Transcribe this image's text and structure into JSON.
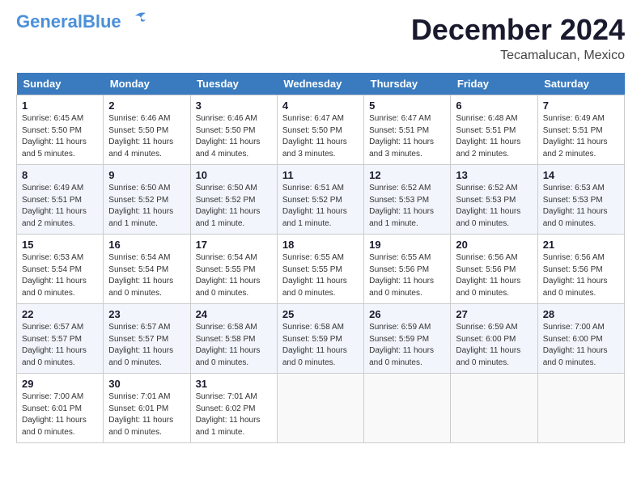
{
  "logo": {
    "part1": "General",
    "part2": "Blue"
  },
  "title": {
    "month": "December 2024",
    "location": "Tecamalucan, Mexico"
  },
  "weekdays": [
    "Sunday",
    "Monday",
    "Tuesday",
    "Wednesday",
    "Thursday",
    "Friday",
    "Saturday"
  ],
  "weeks": [
    [
      {
        "day": "1",
        "sunrise": "6:45 AM",
        "sunset": "5:50 PM",
        "daylight": "11 hours and 5 minutes."
      },
      {
        "day": "2",
        "sunrise": "6:46 AM",
        "sunset": "5:50 PM",
        "daylight": "11 hours and 4 minutes."
      },
      {
        "day": "3",
        "sunrise": "6:46 AM",
        "sunset": "5:50 PM",
        "daylight": "11 hours and 4 minutes."
      },
      {
        "day": "4",
        "sunrise": "6:47 AM",
        "sunset": "5:50 PM",
        "daylight": "11 hours and 3 minutes."
      },
      {
        "day": "5",
        "sunrise": "6:47 AM",
        "sunset": "5:51 PM",
        "daylight": "11 hours and 3 minutes."
      },
      {
        "day": "6",
        "sunrise": "6:48 AM",
        "sunset": "5:51 PM",
        "daylight": "11 hours and 2 minutes."
      },
      {
        "day": "7",
        "sunrise": "6:49 AM",
        "sunset": "5:51 PM",
        "daylight": "11 hours and 2 minutes."
      }
    ],
    [
      {
        "day": "8",
        "sunrise": "6:49 AM",
        "sunset": "5:51 PM",
        "daylight": "11 hours and 2 minutes."
      },
      {
        "day": "9",
        "sunrise": "6:50 AM",
        "sunset": "5:52 PM",
        "daylight": "11 hours and 1 minute."
      },
      {
        "day": "10",
        "sunrise": "6:50 AM",
        "sunset": "5:52 PM",
        "daylight": "11 hours and 1 minute."
      },
      {
        "day": "11",
        "sunrise": "6:51 AM",
        "sunset": "5:52 PM",
        "daylight": "11 hours and 1 minute."
      },
      {
        "day": "12",
        "sunrise": "6:52 AM",
        "sunset": "5:53 PM",
        "daylight": "11 hours and 1 minute."
      },
      {
        "day": "13",
        "sunrise": "6:52 AM",
        "sunset": "5:53 PM",
        "daylight": "11 hours and 0 minutes."
      },
      {
        "day": "14",
        "sunrise": "6:53 AM",
        "sunset": "5:53 PM",
        "daylight": "11 hours and 0 minutes."
      }
    ],
    [
      {
        "day": "15",
        "sunrise": "6:53 AM",
        "sunset": "5:54 PM",
        "daylight": "11 hours and 0 minutes."
      },
      {
        "day": "16",
        "sunrise": "6:54 AM",
        "sunset": "5:54 PM",
        "daylight": "11 hours and 0 minutes."
      },
      {
        "day": "17",
        "sunrise": "6:54 AM",
        "sunset": "5:55 PM",
        "daylight": "11 hours and 0 minutes."
      },
      {
        "day": "18",
        "sunrise": "6:55 AM",
        "sunset": "5:55 PM",
        "daylight": "11 hours and 0 minutes."
      },
      {
        "day": "19",
        "sunrise": "6:55 AM",
        "sunset": "5:56 PM",
        "daylight": "11 hours and 0 minutes."
      },
      {
        "day": "20",
        "sunrise": "6:56 AM",
        "sunset": "5:56 PM",
        "daylight": "11 hours and 0 minutes."
      },
      {
        "day": "21",
        "sunrise": "6:56 AM",
        "sunset": "5:56 PM",
        "daylight": "11 hours and 0 minutes."
      }
    ],
    [
      {
        "day": "22",
        "sunrise": "6:57 AM",
        "sunset": "5:57 PM",
        "daylight": "11 hours and 0 minutes."
      },
      {
        "day": "23",
        "sunrise": "6:57 AM",
        "sunset": "5:57 PM",
        "daylight": "11 hours and 0 minutes."
      },
      {
        "day": "24",
        "sunrise": "6:58 AM",
        "sunset": "5:58 PM",
        "daylight": "11 hours and 0 minutes."
      },
      {
        "day": "25",
        "sunrise": "6:58 AM",
        "sunset": "5:59 PM",
        "daylight": "11 hours and 0 minutes."
      },
      {
        "day": "26",
        "sunrise": "6:59 AM",
        "sunset": "5:59 PM",
        "daylight": "11 hours and 0 minutes."
      },
      {
        "day": "27",
        "sunrise": "6:59 AM",
        "sunset": "6:00 PM",
        "daylight": "11 hours and 0 minutes."
      },
      {
        "day": "28",
        "sunrise": "7:00 AM",
        "sunset": "6:00 PM",
        "daylight": "11 hours and 0 minutes."
      }
    ],
    [
      {
        "day": "29",
        "sunrise": "7:00 AM",
        "sunset": "6:01 PM",
        "daylight": "11 hours and 0 minutes."
      },
      {
        "day": "30",
        "sunrise": "7:01 AM",
        "sunset": "6:01 PM",
        "daylight": "11 hours and 0 minutes."
      },
      {
        "day": "31",
        "sunrise": "7:01 AM",
        "sunset": "6:02 PM",
        "daylight": "11 hours and 1 minute."
      },
      null,
      null,
      null,
      null
    ]
  ],
  "labels": {
    "sunrise": "Sunrise:",
    "sunset": "Sunset:",
    "daylight": "Daylight:"
  }
}
